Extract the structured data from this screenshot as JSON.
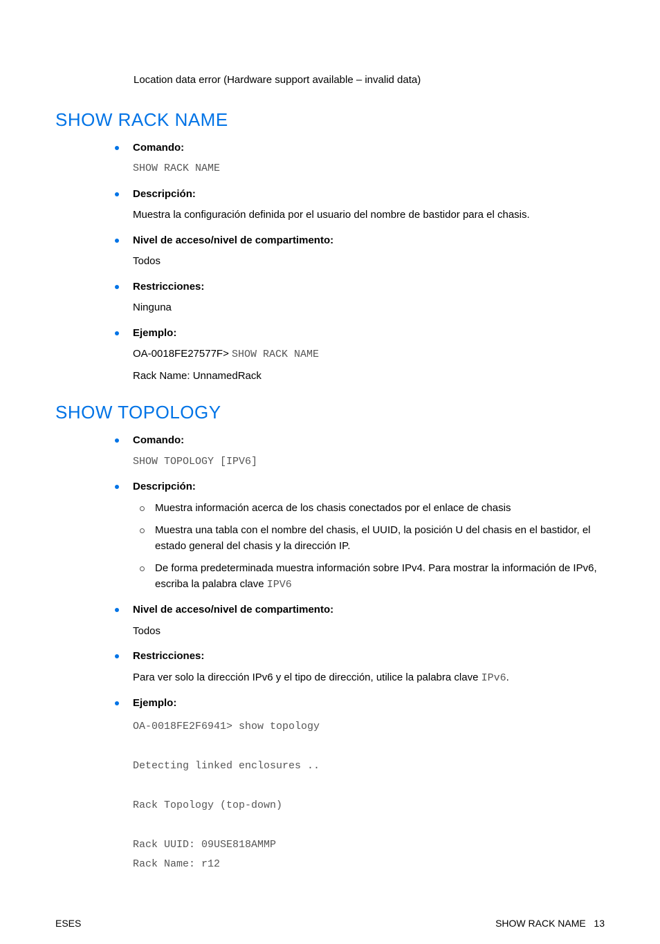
{
  "intro": "Location data error (Hardware support available – invalid data)",
  "sections": [
    {
      "title": "SHOW RACK NAME",
      "items": [
        {
          "label": "Comando:",
          "body_mono": "SHOW RACK NAME"
        },
        {
          "label": "Descripción:",
          "body_text": "Muestra la configuración definida por el usuario del nombre de bastidor para el chasis."
        },
        {
          "label": "Nivel de acceso/nivel de compartimento:",
          "body_text": "Todos"
        },
        {
          "label": "Restricciones:",
          "body_text": "Ninguna"
        },
        {
          "label": "Ejemplo:",
          "example_prefix": "OA-0018FE27577F> ",
          "example_mono": "SHOW RACK NAME",
          "example_line2": "Rack Name: UnnamedRack"
        }
      ]
    },
    {
      "title": "SHOW TOPOLOGY",
      "items": [
        {
          "label": "Comando:",
          "body_mono": "SHOW TOPOLOGY [IPV6]"
        },
        {
          "label": "Descripción:",
          "sublist": [
            {
              "text": "Muestra información acerca de los chasis conectados por el enlace de chasis"
            },
            {
              "text": "Muestra una tabla con el nombre del chasis, el UUID, la posición U del chasis en el bastidor, el estado general del chasis y la dirección IP."
            },
            {
              "text_before": "De forma predeterminada muestra información sobre IPv4. Para mostrar la información de IPv6, escriba la palabra clave ",
              "mono": "IPV6"
            }
          ]
        },
        {
          "label": "Nivel de acceso/nivel de compartimento:",
          "body_text": "Todos"
        },
        {
          "label": "Restricciones:",
          "body_text_before": "Para ver solo la dirección IPv6 y el tipo de dirección, utilice la palabra clave ",
          "body_mono_inline": "IPv6",
          "body_text_after": "."
        },
        {
          "label": "Ejemplo:",
          "code_block": "OA-0018FE2F6941> show topology\n\nDetecting linked enclosures ..\n\nRack Topology (top-down)\n\nRack UUID: 09USE818AMMP\nRack Name: r12"
        }
      ]
    }
  ],
  "footer": {
    "left": "ESES",
    "right_label": "SHOW RACK NAME",
    "page": "13"
  }
}
